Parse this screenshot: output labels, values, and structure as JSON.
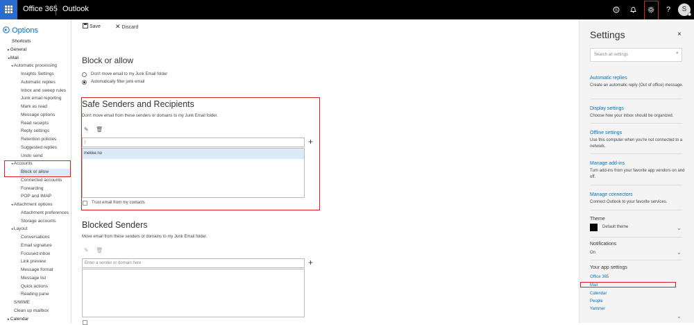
{
  "topbar": {
    "suite_title": "Office 365",
    "app_name": "Outlook",
    "avatar_initial": "S",
    "icons": [
      "skype-icon",
      "bell-icon",
      "gear-icon",
      "help-icon"
    ],
    "help_glyph": "?"
  },
  "leftnav": {
    "back_label": "Options",
    "items": [
      {
        "label": "Shortcuts",
        "level": 0
      },
      {
        "label": "General",
        "level": 0,
        "arrow": "▸"
      },
      {
        "label": "Mail",
        "level": 0,
        "arrow": "◂"
      },
      {
        "label": "Automatic processing",
        "level": 1,
        "arrow": "◂"
      },
      {
        "label": "Insights Settings",
        "level": 2
      },
      {
        "label": "Automatic replies",
        "level": 2
      },
      {
        "label": "Inbox and sweep rules",
        "level": 2
      },
      {
        "label": "Junk email reporting",
        "level": 2
      },
      {
        "label": "Mark as read",
        "level": 2
      },
      {
        "label": "Message options",
        "level": 2
      },
      {
        "label": "Read receipts",
        "level": 2
      },
      {
        "label": "Reply settings",
        "level": 2
      },
      {
        "label": "Retention policies",
        "level": 2
      },
      {
        "label": "Suggested replies",
        "level": 2
      },
      {
        "label": "Undo send",
        "level": 2
      },
      {
        "label": "Accounts",
        "level": 1,
        "arrow": "◂"
      },
      {
        "label": "Block or allow",
        "level": 2,
        "selected": true
      },
      {
        "label": "Connected accounts",
        "level": 2
      },
      {
        "label": "Forwarding",
        "level": 2
      },
      {
        "label": "POP and IMAP",
        "level": 2
      },
      {
        "label": "Attachment options",
        "level": 1,
        "arrow": "◂"
      },
      {
        "label": "Attachment preferences",
        "level": 2
      },
      {
        "label": "Storage accounts",
        "level": 2
      },
      {
        "label": "Layout",
        "level": 1,
        "arrow": "◂"
      },
      {
        "label": "Conversations",
        "level": 2
      },
      {
        "label": "Email signature",
        "level": 2
      },
      {
        "label": "Focused inbox",
        "level": 2
      },
      {
        "label": "Link preview",
        "level": 2
      },
      {
        "label": "Message format",
        "level": 2
      },
      {
        "label": "Message list",
        "level": 2
      },
      {
        "label": "Quick actions",
        "level": 2
      },
      {
        "label": "Reading pane",
        "level": 2
      },
      {
        "label": "S/MIME",
        "level": 1
      },
      {
        "label": "Clean up mailbox",
        "level": 1
      },
      {
        "label": "Calendar",
        "level": 0,
        "arrow": "▸"
      }
    ]
  },
  "main": {
    "save_label": "Save",
    "discard_label": "Discard",
    "block_heading": "Block or allow",
    "radio_dont_move": "Don't move email to my Junk Email folder",
    "radio_auto_filter": "Automatically filter junk email",
    "safe_title": "Safe Senders and Recipients",
    "safe_desc": "Don't move email from these senders or domains to my Junk Email folder.",
    "safe_input_value": "|",
    "safe_list": [
      "mekke.no"
    ],
    "trust_contacts_label": "Trust email from my contacts",
    "blocked_title": "Blocked Senders",
    "blocked_desc": "Move email from these senders or domains to my Junk Email folder.",
    "blocked_placeholder": "Enter a sender or domain here"
  },
  "settings": {
    "title": "Settings",
    "close_glyph": "×",
    "search_placeholder": "Search all settings",
    "links": [
      {
        "title": "Automatic replies",
        "desc": "Create an automatic reply (Out of office) message."
      },
      {
        "title": "Display settings",
        "desc": "Choose how your Inbox should be organized."
      },
      {
        "title": "Offline settings",
        "desc": "Use this computer when you're not connected to a network."
      },
      {
        "title": "Manage add-ins",
        "desc": "Turn add-ins from your favorite app vendors on and off."
      },
      {
        "title": "Manage connectors",
        "desc": "Connect Outlook to your favorite services."
      }
    ],
    "theme_label": "Theme",
    "theme_value": "Default theme",
    "notifications_label": "Notifications",
    "notifications_value": "On",
    "app_settings_label": "Your app settings",
    "app_links": [
      "Office 365",
      "Mail",
      "Calendar",
      "People",
      "Yammer"
    ]
  },
  "colors": {
    "accent": "#0072c6",
    "waffle": "#2a6bd0",
    "highlight_box": "#d82121",
    "selection": "#dbe9f9"
  }
}
